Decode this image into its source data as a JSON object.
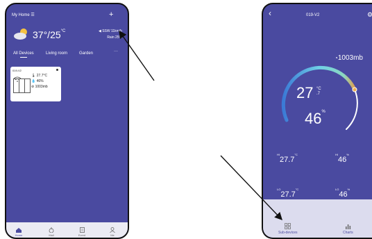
{
  "left": {
    "home_title": "My Home",
    "weather": {
      "temp": "37",
      "sep": "°/25",
      "deg": "°C",
      "wind": "SSW 11km/h",
      "rain": "Rain 25%"
    },
    "tabs": [
      "All Devices",
      "Living room",
      "Garden"
    ],
    "more": "···",
    "add": "+",
    "device": {
      "name": "019-V2",
      "temp": "27.7°C",
      "humidity": "46%",
      "pressure": "1003mb"
    },
    "bottom_tabs": [
      "Home",
      "Mall",
      "Event",
      "Me"
    ]
  },
  "right": {
    "back": "‹",
    "title": "019-V2",
    "pressure": "1003mb",
    "temp_main": "27",
    "temp_unit": "°C",
    "temp_decimal": ".7",
    "humidity_main": "46",
    "humidity_unit": "%",
    "hi_label": "HI",
    "lo_label": "LO",
    "hi_temp": "27.7",
    "hi_temp_unit": "°C",
    "hi_hum": "46",
    "hi_hum_unit": "%",
    "lo_temp": "27.7",
    "lo_temp_unit": "°C",
    "lo_hum": "46",
    "lo_hum_unit": "%",
    "bottom_tabs": [
      "Sub-devices",
      "Charts"
    ]
  }
}
